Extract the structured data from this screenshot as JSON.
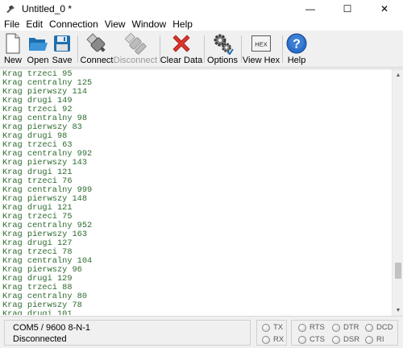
{
  "window": {
    "title": "Untitled_0 *",
    "minimize": "—",
    "maximize": "☐",
    "close": "✕"
  },
  "menu": [
    "File",
    "Edit",
    "Connection",
    "View",
    "Window",
    "Help"
  ],
  "toolbar": {
    "new": "New",
    "open": "Open",
    "save": "Save",
    "connect": "Connect",
    "disconnect": "Disconnect",
    "clear": "Clear Data",
    "options": "Options",
    "viewhex": "View Hex",
    "hex_icon_text": "HEX",
    "help": "Help"
  },
  "terminal": {
    "text_color": "#2e6b2e",
    "lines": [
      "Krag trzeci 95",
      "Krag centralny 125",
      "Krag pierwszy 114",
      "Krag drugi 149",
      "Krag trzeci 92",
      "Krag centralny 98",
      "Krag pierwszy 83",
      "Krag drugi 98",
      "Krag trzeci 63",
      "Krag centralny 992",
      "Krag pierwszy 143",
      "Krag drugi 121",
      "Krag trzeci 76",
      "Krag centralny 999",
      "Krag pierwszy 148",
      "Krag drugi 121",
      "Krag trzeci 75",
      "Krag centralny 952",
      "Krag pierwszy 163",
      "Krag drugi 127",
      "Krag trzeci 78",
      "Krag centralny 104",
      "Krag pierwszy 96",
      "Krag drugi 129",
      "Krag trzeci 88",
      "Krag centralny 80",
      "Krag pierwszy 78",
      "Krag drugi 101"
    ]
  },
  "status": {
    "port": "COM5 / 9600 8-N-1",
    "state": "Disconnected",
    "leds": {
      "tx": "TX",
      "rx": "RX",
      "rts": "RTS",
      "cts": "CTS",
      "dtr": "DTR",
      "dsr": "DSR",
      "dcd": "DCD",
      "ri": "RI"
    }
  }
}
